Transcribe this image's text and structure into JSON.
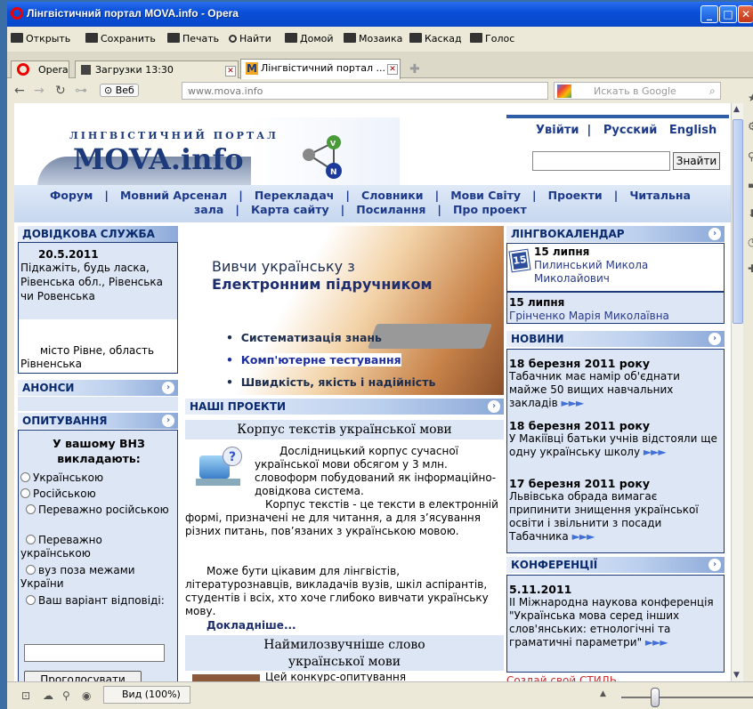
{
  "window": {
    "title": "Лінгвістичний портал MOVA.info - Opera"
  },
  "menubar": {
    "items": [
      "Открыть",
      "Сохранить",
      "Печать",
      "Найти",
      "Домой",
      "Мозаика",
      "Каскад",
      "Голос"
    ]
  },
  "tabs": [
    {
      "label": "Opera"
    },
    {
      "label": "Загрузки 13:30"
    },
    {
      "label": "Лінгвістичний портал ..."
    }
  ],
  "address": {
    "web_label": "Веб",
    "url": "www.mova.info",
    "search_placeholder": "Искать в Google"
  },
  "status": {
    "zoom": "Вид (100%)"
  },
  "site": {
    "logo_top": "ЛІНГВІСТИЧНИЙ ПОРТАЛ",
    "logo_main": "MOVA.info",
    "login": "Увійти",
    "lang1": "Русский",
    "lang2": "English",
    "search_button": "Знайти",
    "nav_row1": "Форум   |   Мовний Арсенал   |   Перекладач   |   Словники   |   Мови Світу   |   Проекти   |   Читальна",
    "nav_row2": "зала   |   Карта сайту   |   Посилання   |   Про проект"
  },
  "left": {
    "help_header": "ДОВІДКОВА СЛУЖБА",
    "help_date": "20.5.2011",
    "help_q": "Підкажіть, будь ласка, Рівенська обл., Рівенська чи Ровенська",
    "help_a1": "місто Рівне, область",
    "help_a2": "Рівненська",
    "announce_header": "АНОНСИ",
    "poll_header": "ОПИТУВАННЯ",
    "poll_question": "У вашому ВНЗ викладають:",
    "poll_options": [
      "Українською",
      "Російською",
      "Переважно російською",
      "Переважно українською",
      "вуз поза межами України",
      "Ваш варіант відповіді:"
    ],
    "vote_button": "Проголосувати"
  },
  "banner": {
    "line1": "Вивчи українську з",
    "line2": "Електронним підручником",
    "bullets": [
      "Систематизація знань",
      "Комп'ютерне тестування",
      "Швидкість, якість і надійність"
    ]
  },
  "projects": {
    "header": "НАШІ ПРОЕКТИ",
    "title1": "Корпус текстів української мови",
    "p1": "Дослідницький корпус сучасної української мови обсягом у 3 млн. словоформ побудований як інформаційно-довідкова система.",
    "p2": "Корпус текстів  - це тексти в електронній формі, призначені не для читання, а для з’ясування різних питань, пов’язаних з українською мовою.",
    "p3": "Може бути цікавим для лінгвістів, літературознавців, викладачів вузів, шкіл аспірантів, студентів і всіх, хто хоче глибоко вивчати українську мову.",
    "more": "Докладніше...",
    "title2": "Наймилозвучніше слово української мови",
    "p4": "Цей конкурс-опитування"
  },
  "right": {
    "cal_header": "ЛІНГВОКАЛЕНДАР",
    "cal1_date": "15 липня",
    "cal1_name": "Пилинський Микола Миколайович",
    "cal2_date": "15 липня",
    "cal2_name": "Грінченко Марія Миколаївна",
    "news_header": "НОВИНИ",
    "news": [
      {
        "date": "18 березня 2011 року",
        "text": "Табачник має намір об'єднати майже 50 вищих навчальних закладів"
      },
      {
        "date": "18 березня 2011 року",
        "text": "У Макіївці батьки учнів відстояли ще одну українську школу"
      },
      {
        "date": "17 березня 2011 року",
        "text": "Львівська обрада вимагає припинити знищення української освіти і звільнити з посади Табачника"
      }
    ],
    "conf_header": "КОНФЕРЕНЦІЇ",
    "conf_date": "5.11.2011",
    "conf_text": "ІІ Міжнародна наукова конференція \"Українська мова серед інших слов'янських: етнологічні та граматичні параметри\"",
    "footer_teaser": "Создай свой СТИЛЬ"
  },
  "colors": {
    "accent": "#0a2a8a",
    "header_bar": "#8ba9d8",
    "arrow_dots": "#4170d8"
  }
}
